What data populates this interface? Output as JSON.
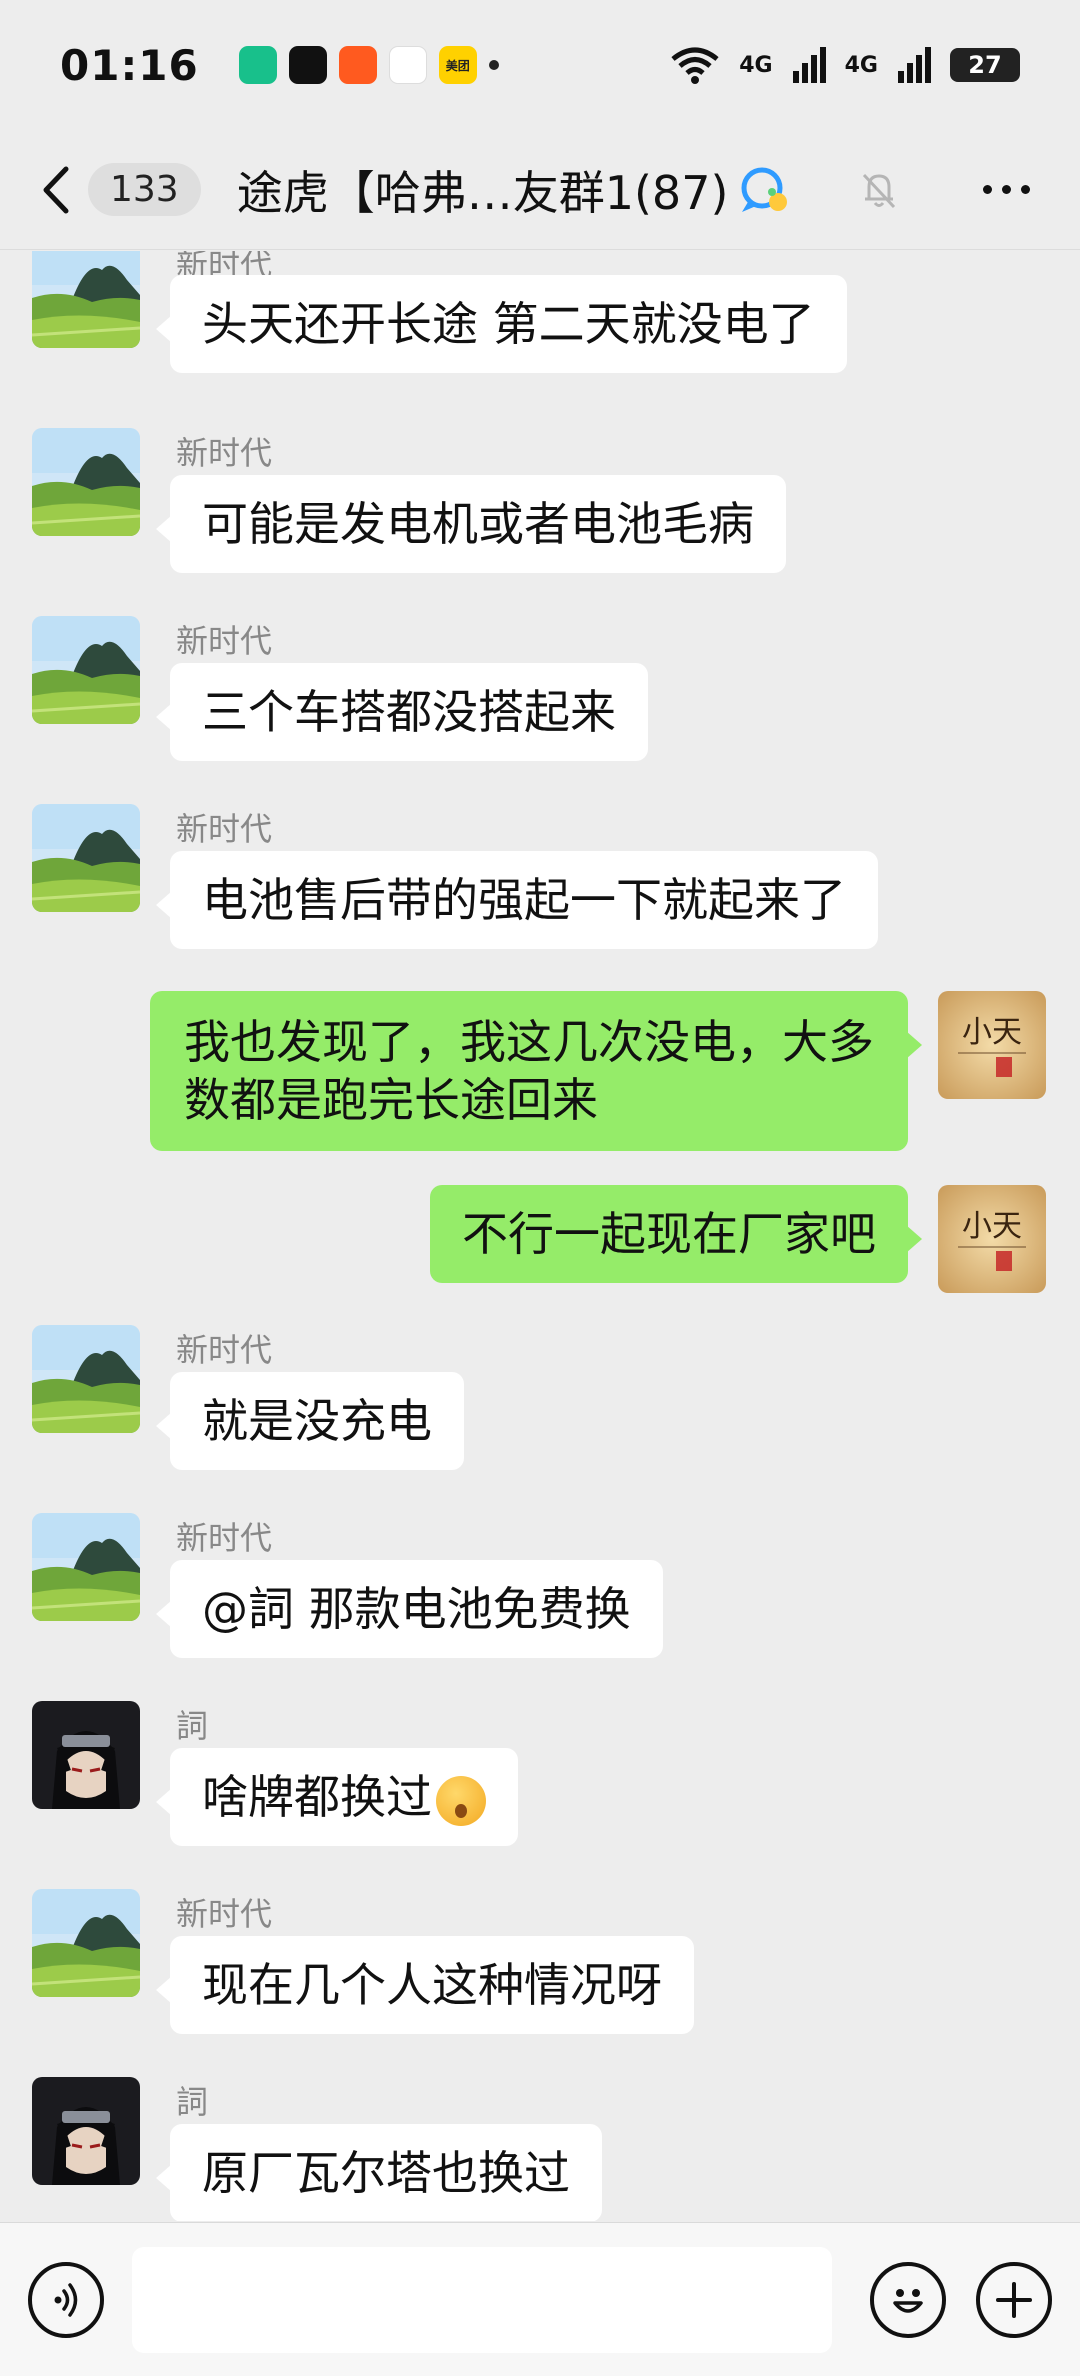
{
  "status_bar": {
    "time": "01:16",
    "app_icons": [
      {
        "name": "app-icon-1",
        "color": "#18c08b",
        "label": ""
      },
      {
        "name": "tiktok-icon",
        "color": "#111111",
        "label": ""
      },
      {
        "name": "app-icon-3",
        "color": "#ff5a1f",
        "label": ""
      },
      {
        "name": "game-icon",
        "color": "#ffffff",
        "label": ""
      },
      {
        "name": "meituan-icon",
        "color": "#ffd100",
        "label": "美团"
      }
    ],
    "signal_1": "4G",
    "signal_2": "4G",
    "battery": "27"
  },
  "header": {
    "unread_count": "133",
    "title": "途虎【哈弗…友群1(87)"
  },
  "messages": [
    {
      "side": "left",
      "sender": "新时代",
      "lines": [
        "头天还开长途 第二天就没电了"
      ],
      "avatar": "landscape"
    },
    {
      "side": "left",
      "sender": "新时代",
      "lines": [
        "可能是发电机或者电池毛病"
      ],
      "avatar": "landscape"
    },
    {
      "side": "left",
      "sender": "新时代",
      "lines": [
        "三个车搭都没搭起来"
      ],
      "avatar": "landscape"
    },
    {
      "side": "left",
      "sender": "新时代",
      "lines": [
        "电池售后带的强起一下就起来了"
      ],
      "avatar": "landscape"
    },
    {
      "side": "right",
      "sender": "",
      "lines": [
        "我也发现了，我这几次没电，大多",
        "数都是跑完长途回来"
      ],
      "avatar": "xiaotian"
    },
    {
      "side": "right",
      "sender": "",
      "lines": [
        "不行一起现在厂家吧"
      ],
      "avatar": "xiaotian"
    },
    {
      "side": "left",
      "sender": "新时代",
      "lines": [
        "就是没充电"
      ],
      "avatar": "landscape"
    },
    {
      "side": "left",
      "sender": "新时代",
      "lines": [
        "@詞  那款电池免费换"
      ],
      "avatar": "landscape"
    },
    {
      "side": "left",
      "sender": "詞",
      "lines": [
        "啥牌都换过"
      ],
      "avatar": "anime",
      "emoji": true
    },
    {
      "side": "left",
      "sender": "新时代",
      "lines": [
        "现在几个人这种情况呀"
      ],
      "avatar": "landscape"
    },
    {
      "side": "left",
      "sender": "詞",
      "lines": [
        "原厂瓦尔塔也换过"
      ],
      "avatar": "anime"
    }
  ],
  "avatar_text": {
    "xiaotian": "小天"
  },
  "input": {
    "placeholder": ""
  },
  "colors": {
    "self_bubble": "#95ec69",
    "other_bubble": "#ffffff",
    "background": "#ededed"
  }
}
